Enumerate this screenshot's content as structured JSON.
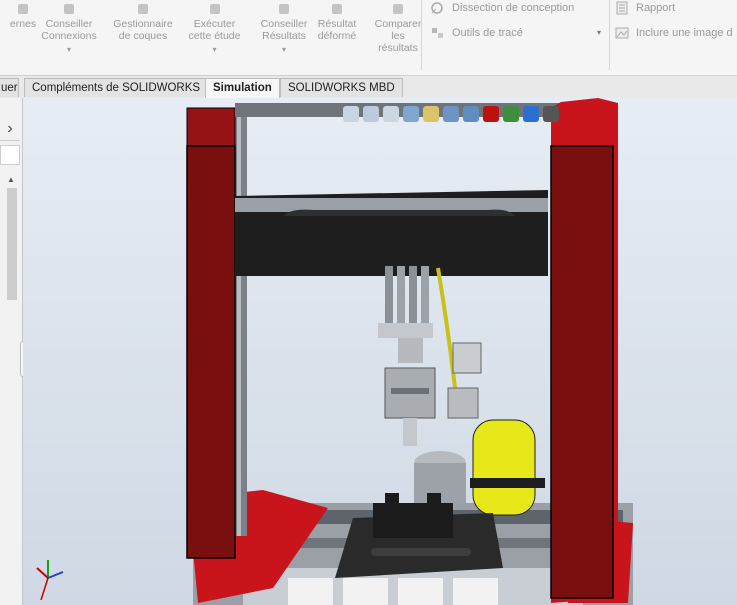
{
  "ribbon": {
    "buttons": [
      {
        "label": "ernes",
        "icon": "externals-icon"
      },
      {
        "label": "Conseiller\nConnexions",
        "icon": "connections-advisor-icon",
        "arrow": "▾"
      },
      {
        "label": "Gestionnaire\nde coques",
        "icon": "shell-manager-icon"
      },
      {
        "label": "Exécuter\ncette étude",
        "icon": "run-study-icon",
        "arrow": "▾"
      },
      {
        "label": "Conseiller\nRésultats",
        "icon": "results-advisor-icon",
        "arrow": "▾"
      },
      {
        "label": "Résultat\ndéformé",
        "icon": "deformed-result-icon"
      },
      {
        "label": "Comparer\nles\nrésultats",
        "icon": "compare-results-icon"
      }
    ],
    "small_buttons": [
      {
        "label": "Dissection de conception",
        "icon": "design-insight-icon"
      },
      {
        "label": "Outils de tracé",
        "icon": "plot-tools-icon"
      }
    ],
    "report_buttons": [
      {
        "label": "Rapport",
        "icon": "report-icon"
      },
      {
        "label": "Inclure une image d",
        "icon": "include-image-icon"
      }
    ]
  },
  "tabs": [
    {
      "label": "uer",
      "active": false
    },
    {
      "label": "Compléments de SOLIDWORKS",
      "active": false
    },
    {
      "label": "Simulation",
      "active": true
    },
    {
      "label": "SOLIDWORKS MBD",
      "active": false
    }
  ],
  "left_panel": {
    "arrow": "›"
  },
  "colors": {
    "frame_red": "#7a0f10",
    "frame_red_bright": "#c8141a",
    "beam_black": "#1e1e1e",
    "tank_yellow": "#e6e81a"
  }
}
